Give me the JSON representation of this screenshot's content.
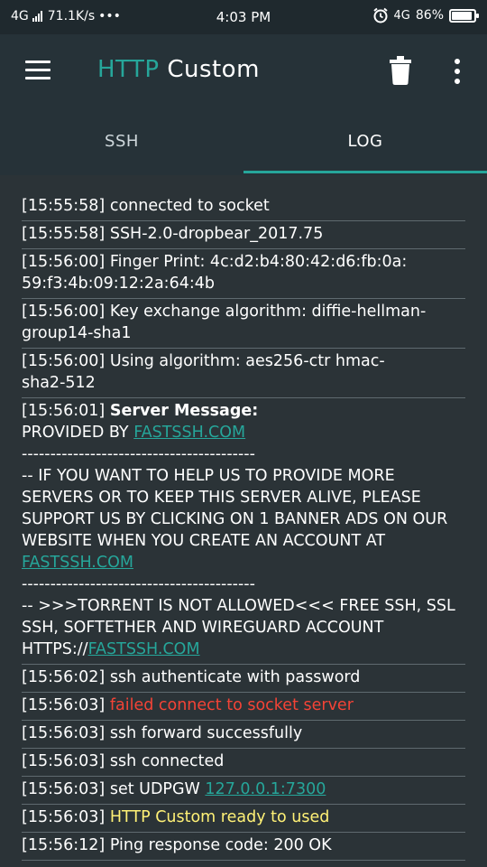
{
  "status_bar": {
    "network": "4G",
    "speed": "71.1K/s",
    "more": "•••",
    "time": "4:03 PM",
    "alarm_icon": "alarm-icon",
    "network_right": "4G",
    "battery": "86%",
    "battery_level": 0.86
  },
  "app_bar": {
    "title_part1": "HTTP",
    "title_part2": "Custom",
    "menu_icon": "hamburger-icon",
    "delete_icon": "trash-icon",
    "more_icon": "more-vertical-icon"
  },
  "tabs": [
    {
      "label": "SSH",
      "active": false
    },
    {
      "label": "LOG",
      "active": true
    }
  ],
  "log": {
    "e1": {
      "ts": "[15:55:58]",
      "text": "connected to socket"
    },
    "e2": {
      "ts": "[15:55:58]",
      "text": "SSH-2.0-dropbear_2017.75"
    },
    "e3": {
      "ts": "[15:56:00]",
      "text": "Finger Print: 4c:d2:b4:80:42:d6:fb:0a:\n59:f3:4b:09:12:2a:64:4b"
    },
    "e4": {
      "ts": "[15:56:00]",
      "text": "Key exchange algorithm: diffie-hellman-\ngroup14-sha1"
    },
    "e5": {
      "ts": "[15:56:00]",
      "text": "Using algorithm: aes256-ctr hmac-\nsha2-512"
    },
    "e6": {
      "ts": "[15:56:01]",
      "label": "Server Message:",
      "provided_by": "PROVIDED BY ",
      "link1": "FASTSSH.COM",
      "sep1": "-----------------------------------------",
      "body1": "-- IF YOU WANT TO HELP US TO PROVIDE MORE SERVERS OR TO KEEP THIS SERVER ALIVE, PLEASE SUPPORT US BY CLICKING ON 1 BANNER ADS ON OUR WEBSITE WHEN YOU CREATE AN ACCOUNT AT ",
      "link2": "FASTSSH.COM",
      "sep2": "-----------------------------------------",
      "body2": "-- >>>TORRENT IS NOT ALLOWED<<< FREE SSH, SSL SSH, SOFTETHER AND WIREGUARD ACCOUNT HTTPS://",
      "link3": "FASTSSH.COM"
    },
    "e7": {
      "ts": "[15:56:02]",
      "text": "ssh authenticate with password"
    },
    "e8": {
      "ts": "[15:56:03]",
      "text": "failed connect to socket server"
    },
    "e9": {
      "ts": "[15:56:03]",
      "text": "ssh forward successfully"
    },
    "e10": {
      "ts": "[15:56:03]",
      "text": "ssh connected"
    },
    "e11": {
      "ts": "[15:56:03]",
      "text": "set UDPGW ",
      "link": "127.0.0.1:7300"
    },
    "e12": {
      "ts": "[15:56:03]",
      "text": "HTTP Custom ready to used"
    },
    "e13": {
      "ts": "[15:56:12]",
      "text": "Ping response code: 200 OK"
    }
  },
  "colors": {
    "accent": "#26a69a",
    "error": "#f44336",
    "highlight": "#fff176",
    "background": "#263238"
  }
}
